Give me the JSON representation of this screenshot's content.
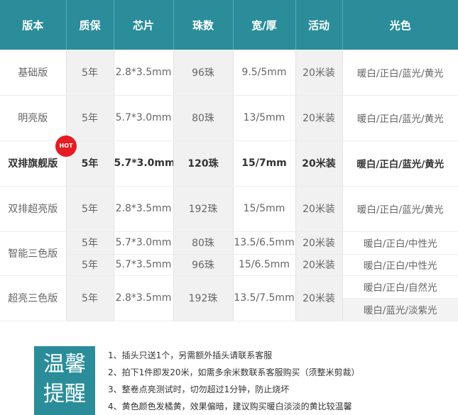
{
  "headers": [
    "版本",
    "质保",
    "芯片",
    "珠数",
    "宽/厚",
    "活动",
    "光色"
  ],
  "badge": "HOT",
  "rows": {
    "basic": {
      "name": "基础版",
      "warranty": "5年",
      "chip": "2.8*3.5mm",
      "beads": "96珠",
      "size": "9.5/5mm",
      "promo": "20米装",
      "colors": "暖白/正白/蓝光/黄光"
    },
    "bright": {
      "name": "明亮版",
      "warranty": "5年",
      "chip": "5.7*3.0mm",
      "beads": "80珠",
      "size": "13/5mm",
      "promo": "20米装",
      "colors": "暖白/正白/蓝光/黄光"
    },
    "flagship": {
      "name": "双排旗舰版",
      "warranty": "5年",
      "chip": "5.7*3.0mm",
      "beads": "120珠",
      "size": "15/7mm",
      "promo": "20米装",
      "colors": "暖白/正白/蓝光/黄光"
    },
    "double": {
      "name": "双排超亮版",
      "warranty": "5年",
      "chip": "2.8*3.5mm",
      "beads": "192珠",
      "size": "15/5mm",
      "promo": "20米装",
      "colors": "暖白/正白/蓝光/黄光"
    },
    "smart1": {
      "name": "智能三色版",
      "warranty": "5年",
      "chip": "5.7*3.0mm",
      "beads": "80珠",
      "size": "13.5/6.5mm",
      "promo": "20米装",
      "colors": "暖白/正白/中性光"
    },
    "smart2": {
      "warranty": "5年",
      "chip": "5.7*3.5mm",
      "beads": "96珠",
      "size": "15/6.5mm",
      "promo": "20米装",
      "colors": "暖白/正白/中性光"
    },
    "super": {
      "name": "超亮三色版",
      "warranty": "5年",
      "chip": "2.8*3.5mm",
      "beads": "192珠",
      "size": "13.5/7.5mm",
      "promo": "20米装",
      "colors": "暖白/正白/自然光",
      "colors2": "暖白/蓝光/淡紫光"
    }
  },
  "reminder": {
    "title_line1": "温馨",
    "title_line2": "提醒",
    "notes": [
      "1、插头只送1个，另需额外插头请联系客服",
      "2、拍下1件即发20米，如需多余米数联系客服购买（须整米剪裁）",
      "3、整卷点亮测试时，切勿超过1分钟，防止烧坏",
      "4、黄色颜色发橘黄，效果偏暗，建议购买暖白淡淡的黄比较温馨"
    ]
  },
  "colors": {
    "header_bg": "#2a8d99",
    "badge_bg": "#e51c23",
    "alt_column_bg": "#f1f1f1"
  }
}
